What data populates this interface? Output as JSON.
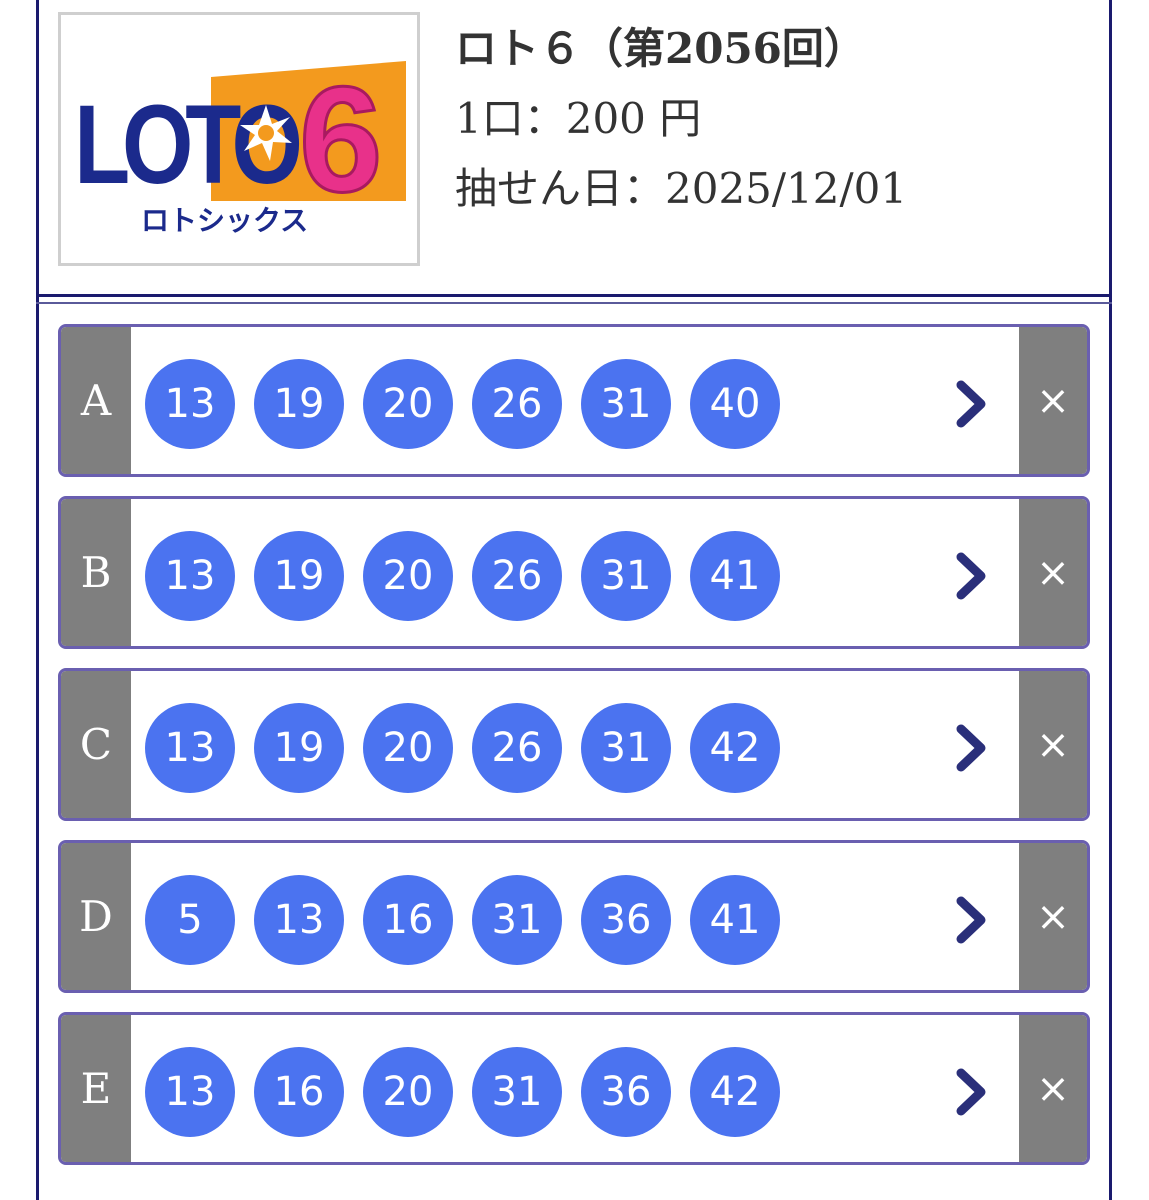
{
  "header": {
    "title": "ロト６（第2056回）",
    "price_line": "1口：200 円",
    "draw_date_line": "抽せん日：2025/12/01"
  },
  "logo": {
    "text_main": "LOTO",
    "text_digit": "6",
    "text_kana": "ロトシックス"
  },
  "colors": {
    "ball": "#4b73f0",
    "side_gray": "#7f7f7f",
    "frame": "#1a1a6e",
    "row_border": "#6a5fb0",
    "chevron": "#2a2f7a"
  },
  "rows": [
    {
      "label": "A",
      "numbers": [
        "13",
        "19",
        "20",
        "26",
        "31",
        "40"
      ],
      "delete_symbol": "×",
      "open_icon": "chevron-right-icon"
    },
    {
      "label": "B",
      "numbers": [
        "13",
        "19",
        "20",
        "26",
        "31",
        "41"
      ],
      "delete_symbol": "×",
      "open_icon": "chevron-right-icon"
    },
    {
      "label": "C",
      "numbers": [
        "13",
        "19",
        "20",
        "26",
        "31",
        "42"
      ],
      "delete_symbol": "×",
      "open_icon": "chevron-right-icon"
    },
    {
      "label": "D",
      "numbers": [
        "5",
        "13",
        "16",
        "31",
        "36",
        "41"
      ],
      "delete_symbol": "×",
      "open_icon": "chevron-right-icon"
    },
    {
      "label": "E",
      "numbers": [
        "13",
        "16",
        "20",
        "31",
        "36",
        "42"
      ],
      "delete_symbol": "×",
      "open_icon": "chevron-right-icon"
    }
  ]
}
